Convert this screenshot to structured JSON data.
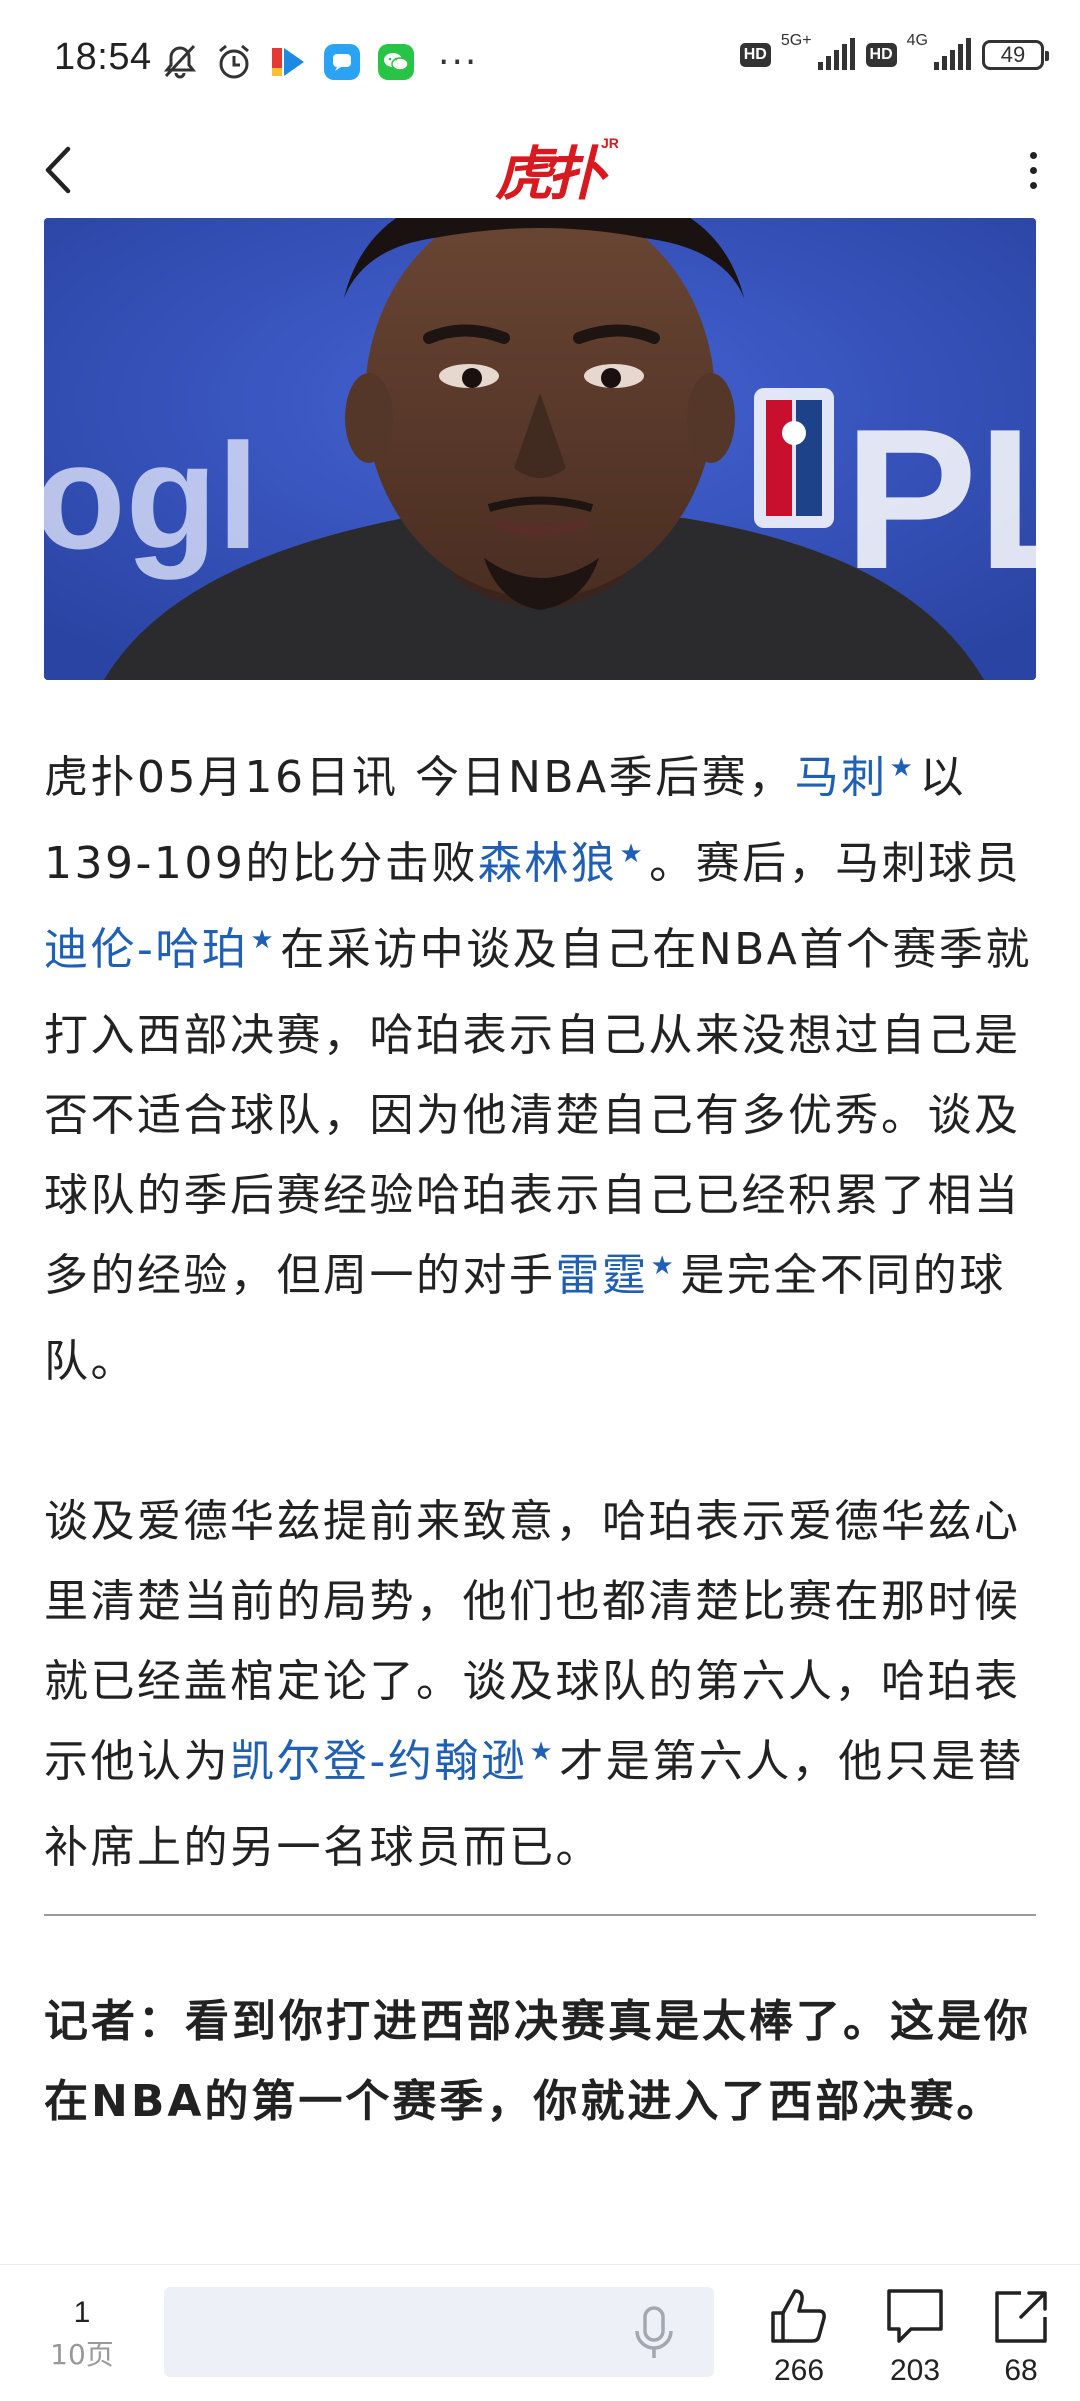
{
  "status_bar": {
    "time": "18:54",
    "icons_left": [
      "mute-icon",
      "alarm-icon",
      "video-app-icon",
      "chat-app-icon",
      "wechat-icon"
    ],
    "more": "···",
    "network1": "5G+",
    "network2": "4G",
    "hd": "HD",
    "battery": "49"
  },
  "nav": {
    "logo_text": "虎扑",
    "logo_sup": "JR"
  },
  "article": {
    "p1": [
      {
        "t": "虎扑05月16日讯 今日NBA季后赛，"
      },
      {
        "t": "马刺",
        "tag": true
      },
      {
        "t": "以139-109的比分击败"
      },
      {
        "t": "森林狼",
        "tag": true
      },
      {
        "t": "。赛后，马刺球员"
      },
      {
        "t": "迪伦-哈珀",
        "tag": true
      },
      {
        "t": "在采访中谈及自己在NBA首个赛季就打入西部决赛，哈珀表示自己从来没想过自己是否不适合球队，因为他清楚自己有多优秀。谈及球队的季后赛经验哈珀表示自己已经积累了相当多的经验，但周一的对手"
      },
      {
        "t": "雷霆",
        "tag": true
      },
      {
        "t": "是完全不同的球队。"
      }
    ],
    "p2": [
      {
        "t": "谈及爱德华兹提前来致意，哈珀表示爱德华兹心里清楚当前的局势，他们也都清楚比赛在那时候就已经盖棺定论了。谈及球队的第六人，哈珀表示他认为"
      },
      {
        "t": "凯尔登-约翰逊",
        "tag": true
      },
      {
        "t": "才是第六人，他只是替补席上的另一名球员而已。"
      }
    ],
    "qa": "记者：看到你打进西部决赛真是太棒了。这是你在NBA的第一个赛季，你就进入了西部决赛。",
    "tag_color": "#1f5fb4"
  },
  "bottom_bar": {
    "page_current": "1",
    "page_total": "10页",
    "comment_placeholder": "                    ",
    "likes": "266",
    "comments": "203",
    "shares": "68"
  }
}
